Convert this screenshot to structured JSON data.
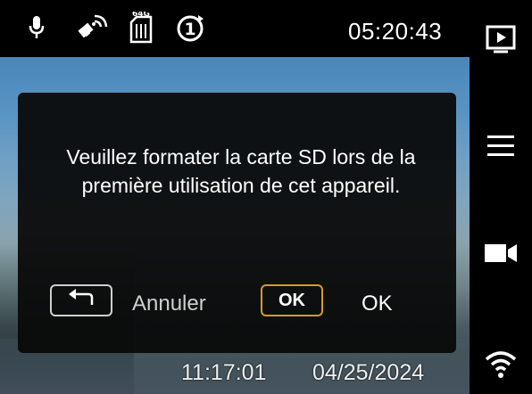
{
  "status_bar": {
    "icons": [
      "microphone-icon",
      "gps-satellite-icon",
      "sd-card-64g-icon",
      "loop-recording-1min-icon"
    ],
    "sd_capacity": "64G",
    "loop_minutes": "1",
    "time": "05:20:43"
  },
  "side_panel": {
    "buttons": [
      "playback-icon",
      "menu-icon",
      "video-record-icon",
      "wifi-icon"
    ]
  },
  "dialog": {
    "message": "Veuillez formater la carte SD lors de la première utilisation de cet appareil.",
    "cancel_label": "Annuler",
    "ok_key": "OK",
    "ok_label": "OK"
  },
  "overlay": {
    "time": "11:17:01",
    "date": "04/25/2024"
  },
  "colors": {
    "background": "#000000",
    "ok_key_border": "#d79a23",
    "dialog_background": "#080808"
  }
}
